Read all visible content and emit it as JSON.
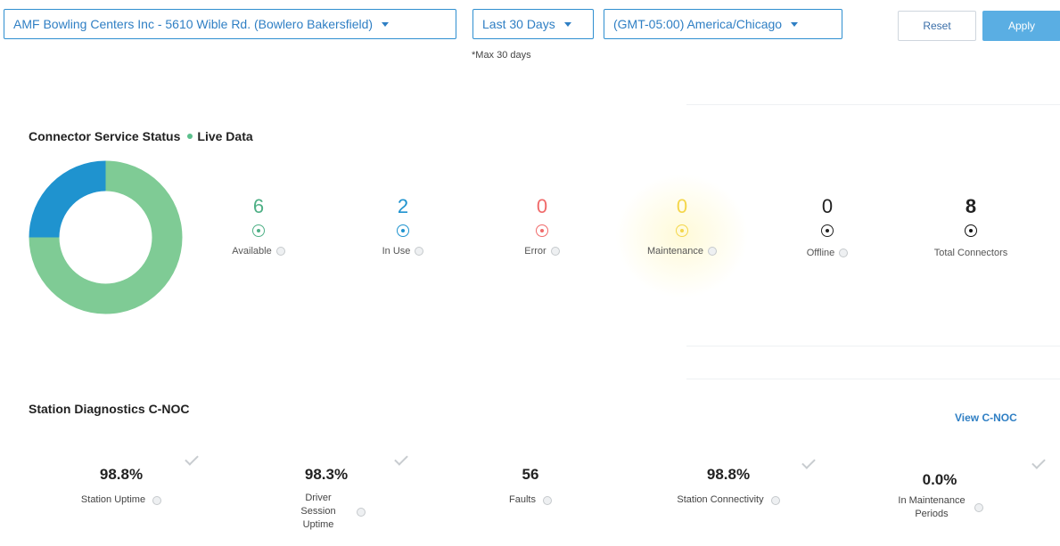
{
  "filters": {
    "location": "AMF Bowling Centers Inc - 5610 Wible Rd. (Bowlero Bakersfield)",
    "date_range": "Last 30 Days",
    "timezone": "(GMT-05:00) America/Chicago",
    "max_note": "*Max 30 days",
    "reset_label": "Reset",
    "apply_label": "Apply"
  },
  "connector_status": {
    "title": "Connector Service Status",
    "live_label": "Live Data",
    "stats": [
      {
        "label": "Available",
        "value": "6",
        "color": "#4fb086"
      },
      {
        "label": "In Use",
        "value": "2",
        "color": "#1f93cf"
      },
      {
        "label": "Error",
        "value": "0",
        "color": "#f06a6a"
      },
      {
        "label": "Maintenance",
        "value": "0",
        "color": "#f4d64a"
      },
      {
        "label": "Offline",
        "value": "0",
        "color": "#222222"
      },
      {
        "label": "Total Connectors",
        "value": "8",
        "color": "#111111"
      }
    ],
    "donut": {
      "segments": [
        {
          "label": "Available",
          "value": 6,
          "color": "#7fcb95"
        },
        {
          "label": "In Use",
          "value": 2,
          "color": "#1f93cf"
        }
      ]
    }
  },
  "diagnostics": {
    "title": "Station Diagnostics C-NOC",
    "view_link": "View C-NOC",
    "metrics": [
      {
        "value": "98.8%",
        "label": "Station Uptime"
      },
      {
        "value": "98.3%",
        "label": "Driver Session Uptime"
      },
      {
        "value": "56",
        "label": "Faults"
      },
      {
        "value": "98.8%",
        "label": "Station Connectivity"
      },
      {
        "value": "0.0%",
        "label": "In Maintenance Periods"
      }
    ]
  }
}
